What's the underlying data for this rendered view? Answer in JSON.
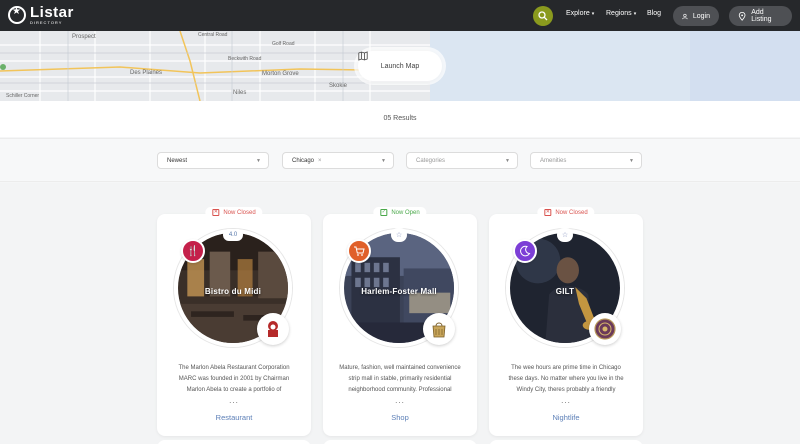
{
  "header": {
    "brand": "Listar",
    "brand_sub": "DIRECTORY",
    "nav": [
      {
        "label": "Explore",
        "caret": "▾"
      },
      {
        "label": "Regions",
        "caret": "▾"
      },
      {
        "label": "Blog",
        "caret": ""
      }
    ],
    "login_label": "Login",
    "add_listing_label": "Add Listing"
  },
  "map": {
    "places": [
      "Prospect",
      "Des Plaines",
      "Schiller Corner",
      "Central Road",
      "Beckwith Road",
      "Morton Grove",
      "Niles",
      "Skokie",
      "Golf Road"
    ],
    "launch_label": "Launch Map"
  },
  "results": {
    "count_text": "05 Results"
  },
  "filters": [
    {
      "value": "Newest",
      "placeholder": false,
      "removable": false
    },
    {
      "value": "Chicago",
      "placeholder": false,
      "removable": true
    },
    {
      "value": "Categories",
      "placeholder": true,
      "removable": false
    },
    {
      "value": "Amenities",
      "placeholder": true,
      "removable": false
    }
  ],
  "listings": [
    {
      "status": "Now Closed",
      "status_state": "closed",
      "title": "Bistro du Midi",
      "rating": "4.0",
      "category": "Restaurant",
      "category_icon": "cutlery-icon",
      "category_color": "#c4204a",
      "description": "The Marlon Abela Restaurant Corporation MARC was founded in 2001 by Chairman Marlon Abela to create a portfolio of",
      "more": "..."
    },
    {
      "status": "Now Open",
      "status_state": "open",
      "title": "Harlem-Foster Mall",
      "rating": "",
      "category": "Shop",
      "category_icon": "cart-icon",
      "category_color": "#e0602a",
      "description": "Mature, fashion, well maintained convenience strip mall in stable, primarily residential neighborhood community. Professional",
      "more": "..."
    },
    {
      "status": "Now Closed",
      "status_state": "closed",
      "title": "GILT",
      "rating": "",
      "category": "Nightlife",
      "category_icon": "moon-icon",
      "category_color": "#7c3ed6",
      "description": "The wee hours are prime time in Chicago these days. No matter where you live in the Windy City, theres probably a friendly",
      "more": "..."
    }
  ]
}
